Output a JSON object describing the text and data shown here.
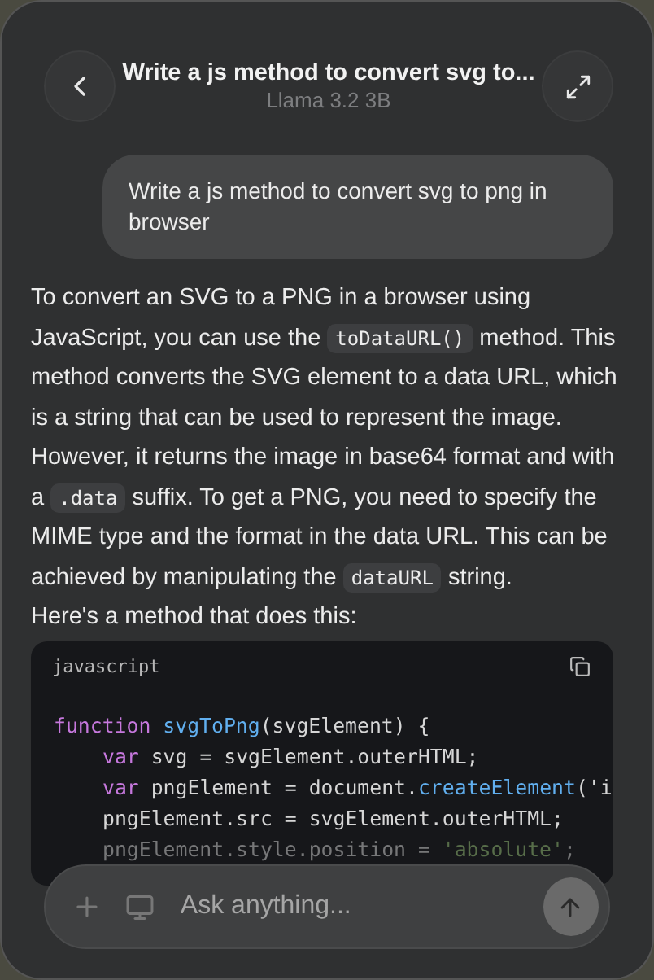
{
  "header": {
    "title": "Write a js method to convert svg to...",
    "subtitle": "Llama 3.2 3B"
  },
  "user_message": "Write a js method to convert svg to png in browser",
  "answer": [
    [
      {
        "kind": "text",
        "text": "To convert an SVG to a PNG in a browser using JavaScript, you can use the "
      },
      {
        "kind": "code",
        "text": "toDataURL()"
      },
      {
        "kind": "text",
        "text": " method. This method converts the SVG element to a data URL, which is a string that can be used to represent the image. However, it returns the image in base64 format and with a "
      },
      {
        "kind": "code",
        "text": ".data"
      },
      {
        "kind": "text",
        "text": " suffix. To get a PNG, you need to specify the MIME type and the format in the data URL. This can be achieved by manipulating the "
      },
      {
        "kind": "code",
        "text": "dataURL"
      },
      {
        "kind": "text",
        "text": " string."
      }
    ],
    [
      {
        "kind": "text",
        "text": "Here's a method that does this:"
      }
    ]
  ],
  "code_block": {
    "language": "javascript",
    "lines": [
      {
        "indented": false,
        "tokens": [
          {
            "kind": "keyword",
            "text": "function"
          },
          {
            "kind": "func",
            "text": " svgToPng"
          },
          {
            "kind": "plain",
            "text": "(svgElement) {"
          }
        ]
      },
      {
        "indented": true,
        "tokens": [
          {
            "kind": "keyword",
            "text": "var"
          },
          {
            "kind": "plain",
            "text": " svg = svgElement.outerHTML;"
          }
        ]
      },
      {
        "indented": true,
        "tokens": [
          {
            "kind": "keyword",
            "text": "var"
          },
          {
            "kind": "plain",
            "text": " pngElement = document."
          },
          {
            "kind": "func",
            "text": "createElement"
          },
          {
            "kind": "plain",
            "text": "('i"
          }
        ]
      },
      {
        "indented": true,
        "tokens": [
          {
            "kind": "plain",
            "text": "pngElement.src = svgElement.outerHTML;"
          }
        ]
      },
      {
        "indented": true,
        "tokens": [
          {
            "kind": "plain",
            "text": "pngElement.style.position = "
          },
          {
            "kind": "string",
            "text": "'absolute'"
          },
          {
            "kind": "plain",
            "text": ";"
          }
        ]
      }
    ]
  },
  "composer": {
    "placeholder": "Ask anything..."
  }
}
